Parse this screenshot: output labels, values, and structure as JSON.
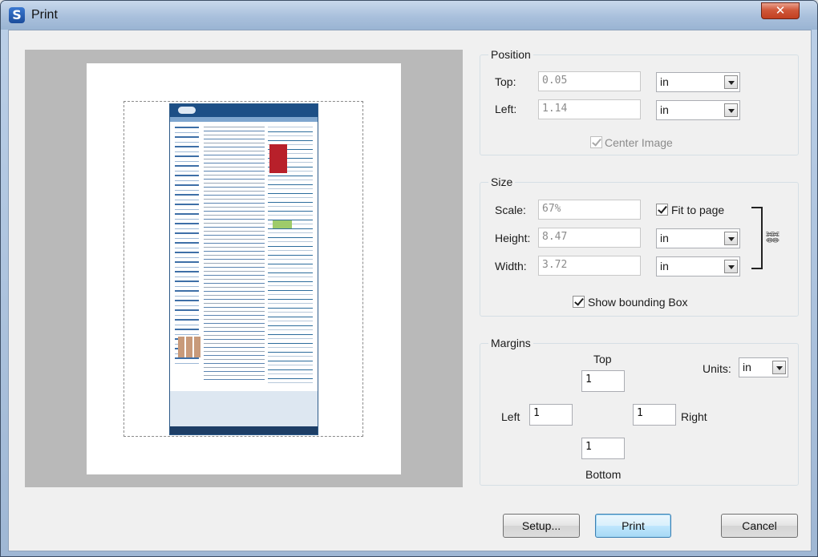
{
  "window": {
    "title": "Print",
    "app_icon_letter": "S",
    "close_glyph": "✕"
  },
  "preview": {},
  "position": {
    "title": "Position",
    "top_label": "Top:",
    "top_value": "0.05",
    "top_unit": "in",
    "left_label": "Left:",
    "left_value": "1.14",
    "left_unit": "in",
    "center_image_label": "Center Image",
    "center_image_checked": true
  },
  "size": {
    "title": "Size",
    "scale_label": "Scale:",
    "scale_value": "67%",
    "fit_label": "Fit to page",
    "fit_checked": true,
    "height_label": "Height:",
    "height_value": "8.47",
    "height_unit": "in",
    "width_label": "Width:",
    "width_value": "3.72",
    "width_unit": "in",
    "show_bbox_label": "Show bounding Box",
    "show_bbox_checked": true,
    "link_icon": "link-icon"
  },
  "margins": {
    "title": "Margins",
    "top_label": "Top",
    "top_value": "1",
    "units_label": "Units:",
    "units_value": "in",
    "left_label": "Left",
    "left_value": "1",
    "right_label": "Right",
    "right_value": "1",
    "bottom_label": "Bottom",
    "bottom_value": "1"
  },
  "buttons": {
    "setup": "Setup...",
    "print": "Print",
    "cancel": "Cancel"
  }
}
